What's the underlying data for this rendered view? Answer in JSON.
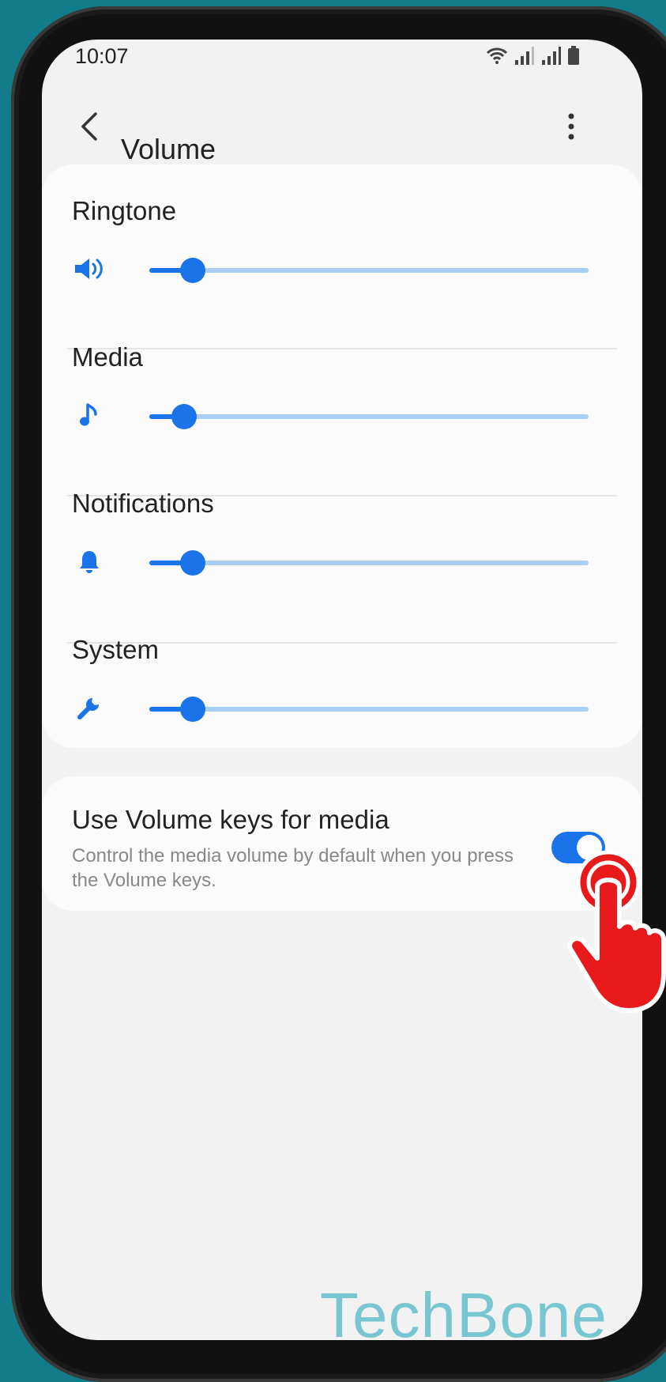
{
  "status_bar": {
    "time": "10:07"
  },
  "app_bar": {
    "title": "Volume"
  },
  "volume_rows": [
    {
      "label": "Ringtone",
      "icon": "speaker-icon",
      "level": 0.07
    },
    {
      "label": "Media",
      "icon": "music-note-icon",
      "level": 0.05
    },
    {
      "label": "Notifications",
      "icon": "bell-icon",
      "level": 0.07
    },
    {
      "label": "System",
      "icon": "wrench-icon",
      "level": 0.07
    }
  ],
  "volume_keys": {
    "title": "Use Volume keys for media",
    "description": "Control the media volume by default when you press the Volume keys.",
    "enabled": true
  },
  "watermark": "TechBone",
  "colors": {
    "accent": "#1a73e8",
    "track": "#a9cff7",
    "background": "#137c8b",
    "pointer": "#e8191b"
  }
}
